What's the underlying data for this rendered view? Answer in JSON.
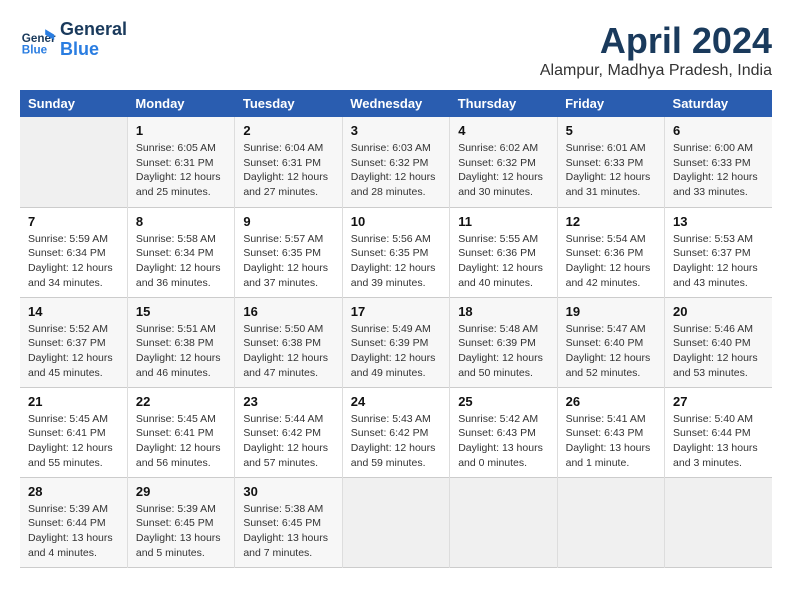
{
  "logo": {
    "line1": "General",
    "line2": "Blue"
  },
  "title": "April 2024",
  "subtitle": "Alampur, Madhya Pradesh, India",
  "days_of_week": [
    "Sunday",
    "Monday",
    "Tuesday",
    "Wednesday",
    "Thursday",
    "Friday",
    "Saturday"
  ],
  "weeks": [
    [
      {
        "day": "",
        "info": ""
      },
      {
        "day": "1",
        "info": "Sunrise: 6:05 AM\nSunset: 6:31 PM\nDaylight: 12 hours\nand 25 minutes."
      },
      {
        "day": "2",
        "info": "Sunrise: 6:04 AM\nSunset: 6:31 PM\nDaylight: 12 hours\nand 27 minutes."
      },
      {
        "day": "3",
        "info": "Sunrise: 6:03 AM\nSunset: 6:32 PM\nDaylight: 12 hours\nand 28 minutes."
      },
      {
        "day": "4",
        "info": "Sunrise: 6:02 AM\nSunset: 6:32 PM\nDaylight: 12 hours\nand 30 minutes."
      },
      {
        "day": "5",
        "info": "Sunrise: 6:01 AM\nSunset: 6:33 PM\nDaylight: 12 hours\nand 31 minutes."
      },
      {
        "day": "6",
        "info": "Sunrise: 6:00 AM\nSunset: 6:33 PM\nDaylight: 12 hours\nand 33 minutes."
      }
    ],
    [
      {
        "day": "7",
        "info": "Sunrise: 5:59 AM\nSunset: 6:34 PM\nDaylight: 12 hours\nand 34 minutes."
      },
      {
        "day": "8",
        "info": "Sunrise: 5:58 AM\nSunset: 6:34 PM\nDaylight: 12 hours\nand 36 minutes."
      },
      {
        "day": "9",
        "info": "Sunrise: 5:57 AM\nSunset: 6:35 PM\nDaylight: 12 hours\nand 37 minutes."
      },
      {
        "day": "10",
        "info": "Sunrise: 5:56 AM\nSunset: 6:35 PM\nDaylight: 12 hours\nand 39 minutes."
      },
      {
        "day": "11",
        "info": "Sunrise: 5:55 AM\nSunset: 6:36 PM\nDaylight: 12 hours\nand 40 minutes."
      },
      {
        "day": "12",
        "info": "Sunrise: 5:54 AM\nSunset: 6:36 PM\nDaylight: 12 hours\nand 42 minutes."
      },
      {
        "day": "13",
        "info": "Sunrise: 5:53 AM\nSunset: 6:37 PM\nDaylight: 12 hours\nand 43 minutes."
      }
    ],
    [
      {
        "day": "14",
        "info": "Sunrise: 5:52 AM\nSunset: 6:37 PM\nDaylight: 12 hours\nand 45 minutes."
      },
      {
        "day": "15",
        "info": "Sunrise: 5:51 AM\nSunset: 6:38 PM\nDaylight: 12 hours\nand 46 minutes."
      },
      {
        "day": "16",
        "info": "Sunrise: 5:50 AM\nSunset: 6:38 PM\nDaylight: 12 hours\nand 47 minutes."
      },
      {
        "day": "17",
        "info": "Sunrise: 5:49 AM\nSunset: 6:39 PM\nDaylight: 12 hours\nand 49 minutes."
      },
      {
        "day": "18",
        "info": "Sunrise: 5:48 AM\nSunset: 6:39 PM\nDaylight: 12 hours\nand 50 minutes."
      },
      {
        "day": "19",
        "info": "Sunrise: 5:47 AM\nSunset: 6:40 PM\nDaylight: 12 hours\nand 52 minutes."
      },
      {
        "day": "20",
        "info": "Sunrise: 5:46 AM\nSunset: 6:40 PM\nDaylight: 12 hours\nand 53 minutes."
      }
    ],
    [
      {
        "day": "21",
        "info": "Sunrise: 5:45 AM\nSunset: 6:41 PM\nDaylight: 12 hours\nand 55 minutes."
      },
      {
        "day": "22",
        "info": "Sunrise: 5:45 AM\nSunset: 6:41 PM\nDaylight: 12 hours\nand 56 minutes."
      },
      {
        "day": "23",
        "info": "Sunrise: 5:44 AM\nSunset: 6:42 PM\nDaylight: 12 hours\nand 57 minutes."
      },
      {
        "day": "24",
        "info": "Sunrise: 5:43 AM\nSunset: 6:42 PM\nDaylight: 12 hours\nand 59 minutes."
      },
      {
        "day": "25",
        "info": "Sunrise: 5:42 AM\nSunset: 6:43 PM\nDaylight: 13 hours\nand 0 minutes."
      },
      {
        "day": "26",
        "info": "Sunrise: 5:41 AM\nSunset: 6:43 PM\nDaylight: 13 hours\nand 1 minute."
      },
      {
        "day": "27",
        "info": "Sunrise: 5:40 AM\nSunset: 6:44 PM\nDaylight: 13 hours\nand 3 minutes."
      }
    ],
    [
      {
        "day": "28",
        "info": "Sunrise: 5:39 AM\nSunset: 6:44 PM\nDaylight: 13 hours\nand 4 minutes."
      },
      {
        "day": "29",
        "info": "Sunrise: 5:39 AM\nSunset: 6:45 PM\nDaylight: 13 hours\nand 5 minutes."
      },
      {
        "day": "30",
        "info": "Sunrise: 5:38 AM\nSunset: 6:45 PM\nDaylight: 13 hours\nand 7 minutes."
      },
      {
        "day": "",
        "info": ""
      },
      {
        "day": "",
        "info": ""
      },
      {
        "day": "",
        "info": ""
      },
      {
        "day": "",
        "info": ""
      }
    ]
  ]
}
